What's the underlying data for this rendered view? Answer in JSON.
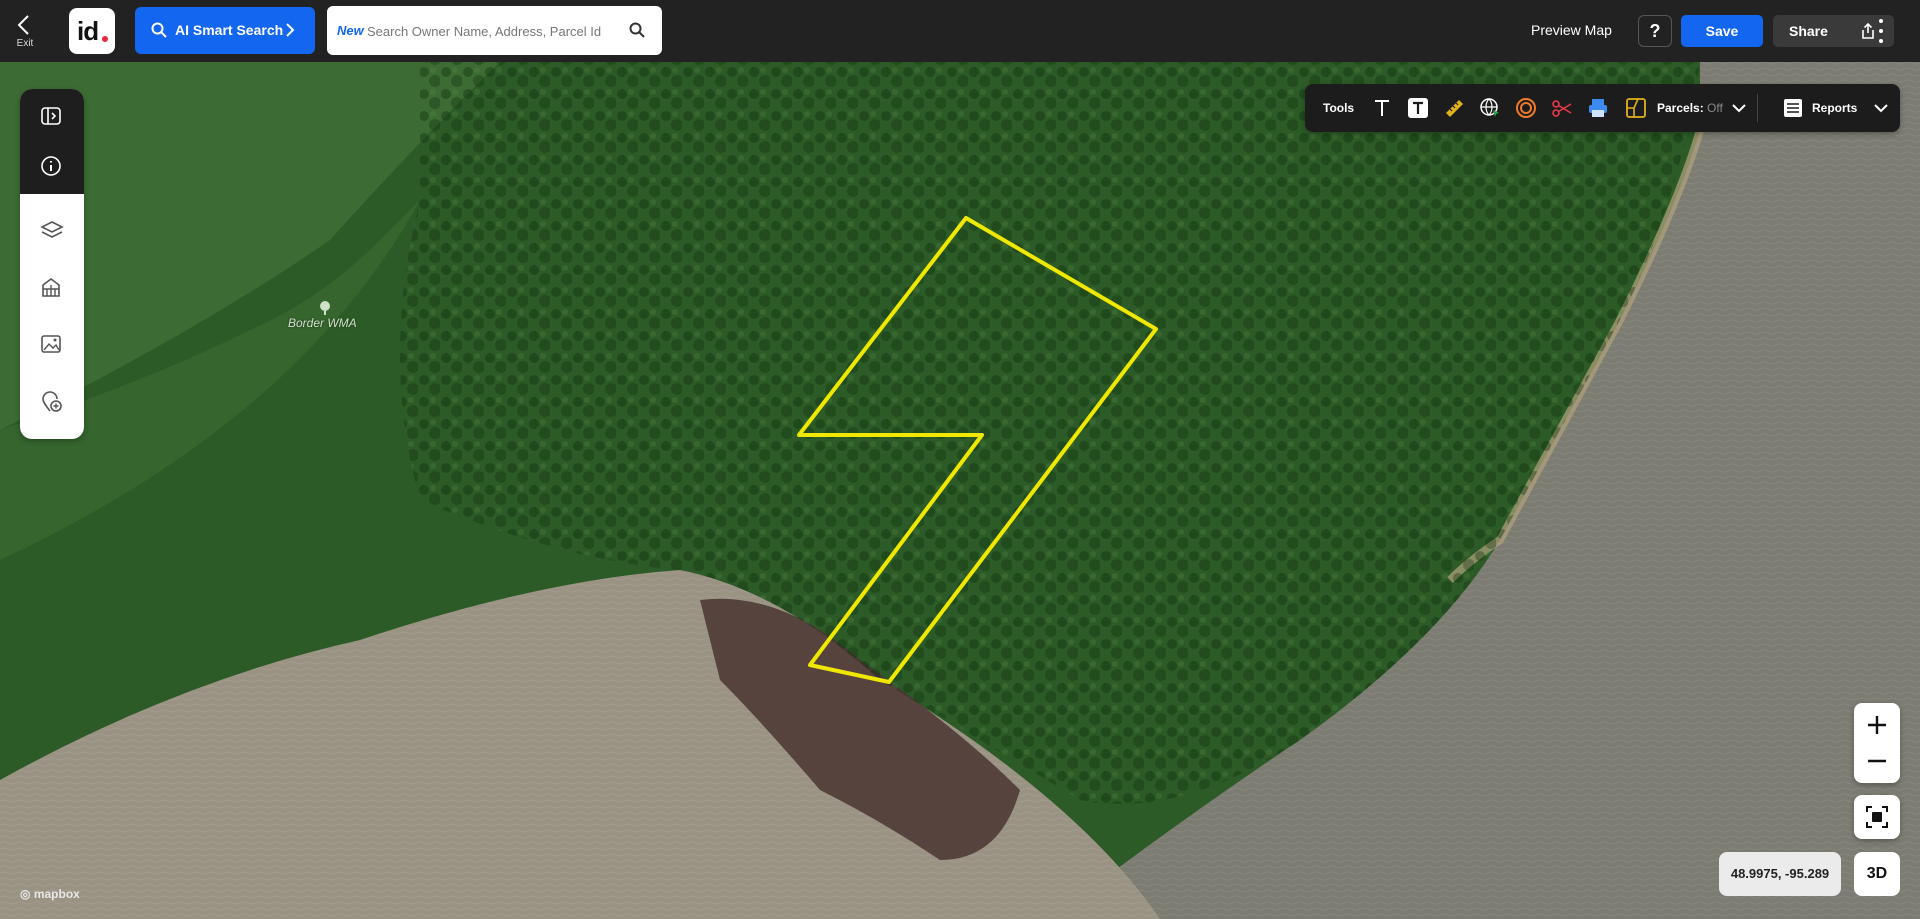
{
  "header": {
    "exit_label": "Exit",
    "logo_text": "id",
    "ai_search_label": "AI Smart Search",
    "search_new_tag": "New",
    "search_placeholder": "Search Owner Name, Address, Parcel Id",
    "preview_map_label": "Preview Map",
    "help_label": "?",
    "save_label": "Save",
    "share_label": "Share"
  },
  "left_rail": {
    "items": [
      "collapse-panel",
      "info",
      "layers",
      "buildings",
      "imagery",
      "add-place"
    ]
  },
  "tools": {
    "label": "Tools",
    "items": [
      "text-tool",
      "text-box-tool",
      "ruler-tool",
      "globe-tool",
      "radius-tool",
      "scissors-tool",
      "print-tool"
    ],
    "parcels_label": "Parcels:",
    "parcels_state": "Off",
    "reports_label": "Reports"
  },
  "map": {
    "poi_label": "Border WMA",
    "attribution": "mapbox",
    "coordinates": "48.9975, -95.289",
    "view_3d_label": "3D",
    "parcel_outline_color": "#f0e800"
  },
  "colors": {
    "brand_blue": "#1366f0",
    "topbar": "#222222",
    "accent_red": "#e8283a"
  }
}
